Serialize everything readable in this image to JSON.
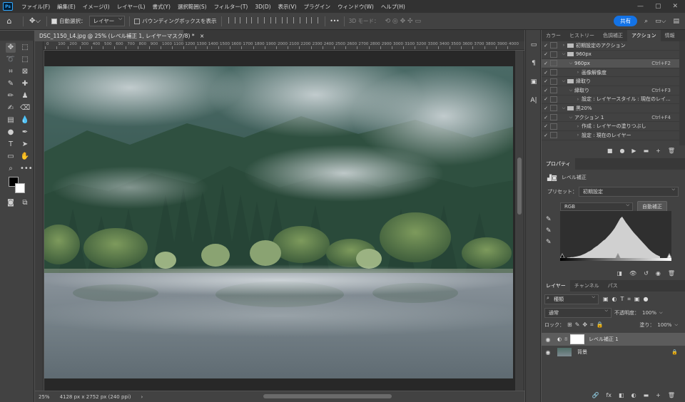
{
  "app": {
    "logo": "Ps"
  },
  "menu": [
    "ファイル(F)",
    "編集(E)",
    "イメージ(I)",
    "レイヤー(L)",
    "書式(Y)",
    "選択範囲(S)",
    "フィルター(T)",
    "3D(D)",
    "表示(V)",
    "プラグイン",
    "ウィンドウ(W)",
    "ヘルプ(H)"
  ],
  "window_controls": {
    "minimize": "—",
    "maximize": "▢",
    "close": "✕"
  },
  "options": {
    "auto_select_label": "自動選択：",
    "auto_select_value": "レイヤー",
    "bounding_box_label": "バウンディングボックスを表示",
    "more": "•••",
    "mode_3d": "3D モード：",
    "share": "共有"
  },
  "document": {
    "tab_title": "DSC_1150_L4.jpg @ 25% (レベル補正 1, レイヤーマスク/8) *",
    "close": "×"
  },
  "ruler": {
    "labels": [
      "0",
      "100",
      "200",
      "300",
      "400",
      "500",
      "600",
      "700",
      "800",
      "900",
      "1000",
      "1100",
      "1200",
      "1300",
      "1400",
      "1500",
      "1600",
      "1700",
      "1800",
      "1900",
      "2000",
      "2100",
      "2200",
      "2300",
      "2400",
      "2500",
      "2600",
      "2700",
      "2800",
      "2900",
      "3000",
      "3100",
      "3200",
      "3300",
      "3400",
      "3500",
      "3600",
      "3700",
      "3800",
      "3900",
      "4000"
    ]
  },
  "status": {
    "zoom": "25%",
    "info": "4128 px x 2752 px (240 ppi)",
    "arrow": "›"
  },
  "panels": {
    "top_tabs": [
      "カラー",
      "ヒストリー",
      "色調補正",
      "アクション",
      "情報"
    ],
    "top_active": 3,
    "actions": [
      {
        "check": "✓",
        "twisty": "›",
        "folder": true,
        "label": "初期設定のアクション",
        "shortcut": "",
        "indent": 0
      },
      {
        "check": "✓",
        "twisty": "⌵",
        "folder": true,
        "label": "960px",
        "shortcut": "",
        "indent": 0
      },
      {
        "check": "✓",
        "twisty": "⌵",
        "folder": false,
        "label": "960px",
        "shortcut": "Ctrl+F2",
        "indent": 1,
        "hl": true
      },
      {
        "check": "✓",
        "twisty": "›",
        "folder": false,
        "label": "画像解像度",
        "shortcut": "",
        "indent": 2
      },
      {
        "check": "✓",
        "twisty": "⌵",
        "folder": true,
        "label": "縁取り",
        "shortcut": "",
        "indent": 0
      },
      {
        "check": "✓",
        "twisty": "⌵",
        "folder": false,
        "label": "縁取り",
        "shortcut": "Ctrl+F3",
        "indent": 1
      },
      {
        "check": "✓",
        "twisty": "›",
        "folder": false,
        "label": "設定 : レイヤースタイル : 現在のレイ...",
        "shortcut": "",
        "indent": 2
      },
      {
        "check": "✓",
        "twisty": "⌵",
        "folder": true,
        "label": "黒20%",
        "shortcut": "",
        "indent": 0
      },
      {
        "check": "✓",
        "twisty": "⌵",
        "folder": false,
        "label": "アクション 1",
        "shortcut": "Ctrl+F4",
        "indent": 1
      },
      {
        "check": "✓",
        "twisty": "›",
        "folder": false,
        "label": "作成 : レイヤーの塗りつぶし",
        "shortcut": "",
        "indent": 2
      },
      {
        "check": "✓",
        "twisty": "›",
        "folder": false,
        "label": "設定 : 現在のレイヤー",
        "shortcut": "",
        "indent": 2
      }
    ],
    "action_buttons": [
      "■",
      "●",
      "▶",
      "▬",
      "+",
      "🗑"
    ],
    "properties": {
      "tab": "プロパティ",
      "title": "レベル補正",
      "preset_label": "プリセット：",
      "preset_value": "初期設定",
      "channel": "RGB",
      "auto_button": "自動補正",
      "histogram": [
        0.01,
        0.01,
        0.02,
        0.02,
        0.03,
        0.04,
        0.05,
        0.06,
        0.08,
        0.1,
        0.12,
        0.15,
        0.17,
        0.2,
        0.24,
        0.27,
        0.3,
        0.34,
        0.38,
        0.42,
        0.45,
        0.5,
        0.55,
        0.6,
        0.66,
        0.72,
        0.8,
        0.88,
        0.96,
        1.0,
        0.93,
        0.86,
        0.8,
        0.74,
        0.68,
        0.62,
        0.57,
        0.52,
        0.47,
        0.42,
        0.37,
        0.32,
        0.27,
        0.22,
        0.18,
        0.14,
        0.11,
        0.08,
        0.06,
        0.04
      ]
    },
    "layers": {
      "tabs": [
        "レイヤー",
        "チャンネル",
        "パス"
      ],
      "filter_label": "種類",
      "blend_mode": "通常",
      "opacity_label": "不透明度：",
      "opacity_value": "100%",
      "lock_label": "ロック：",
      "fill_label": "塗り：",
      "fill_value": "100%",
      "items": [
        {
          "name": "レベル補正 1",
          "selected": true
        },
        {
          "name": "背景",
          "selected": false,
          "locked": true
        }
      ],
      "bottom_icons": [
        "🔗",
        "fx",
        "◧",
        "◐",
        "▬",
        "+",
        "🗑"
      ]
    }
  }
}
